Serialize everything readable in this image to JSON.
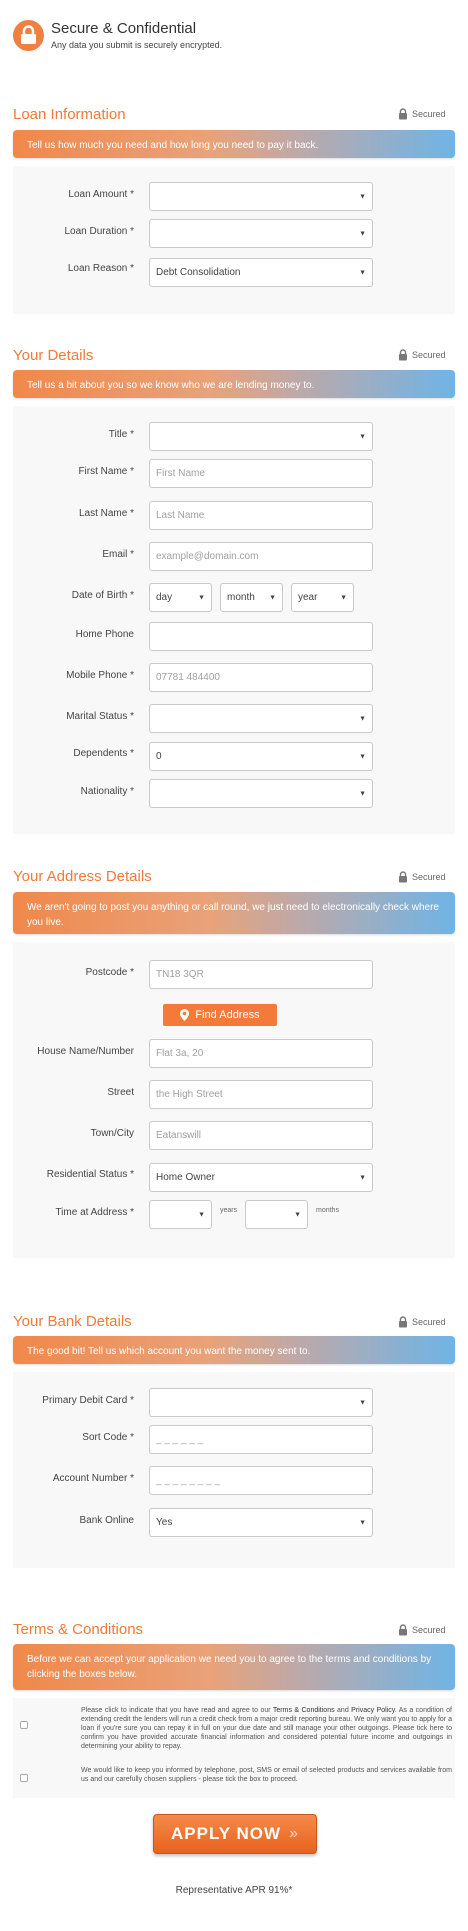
{
  "header": {
    "title": "Secure & Confidential",
    "subtitle": "Any data you submit is securely encrypted.",
    "icon": "lock-icon"
  },
  "secured_label": "Secured",
  "loan": {
    "title": "Loan Information",
    "banner": "Tell us how much you need and how long you need to pay it back.",
    "amount_label": "Loan Amount *",
    "amount_value": "",
    "duration_label": "Loan Duration *",
    "duration_value": "",
    "reason_label": "Loan Reason *",
    "reason_value": "Debt Consolidation"
  },
  "details": {
    "title": "Your Details",
    "banner": "Tell us a bit about you so we know who we are lending money to.",
    "title_label": "Title *",
    "title_value": "",
    "first_label": "First Name *",
    "first_placeholder": "First Name",
    "last_label": "Last Name *",
    "last_placeholder": "Last Name",
    "email_label": "Email *",
    "email_placeholder": "example@domain.com",
    "dob_label": "Date of Birth *",
    "dob_day": "day",
    "dob_month": "month",
    "dob_year": "year",
    "home_label": "Home Phone",
    "mobile_label": "Mobile Phone *",
    "mobile_placeholder": "07781 484400",
    "marital_label": "Marital Status *",
    "marital_value": "",
    "dependents_label": "Dependents *",
    "dependents_value": "0",
    "nationality_label": "Nationality *",
    "nationality_value": ""
  },
  "address": {
    "title": "Your Address Details",
    "banner": "We aren't going to post you anything or call round, we just need to electronically check where you live.",
    "postcode_label": "Postcode *",
    "postcode_placeholder": "TN18 3QR",
    "find_button": "Find Address",
    "house_label": "House Name/Number",
    "house_placeholder": "Flat 3a, 20",
    "street_label": "Street",
    "street_placeholder": "the High Street",
    "town_label": "Town/City",
    "town_placeholder": "Eatanswill",
    "residential_label": "Residential Status *",
    "residential_value": "Home Owner",
    "time_label": "Time at Address *",
    "years_unit": "years",
    "months_unit": "months"
  },
  "bank": {
    "title": "Your Bank Details",
    "banner": "The good bit! Tell us which account you want the money sent to.",
    "card_label": "Primary Debit Card *",
    "card_value": "",
    "sort_label": "Sort Code *",
    "sort_placeholder": "_ _ _ _ _ _",
    "account_label": "Account Number *",
    "account_placeholder": "_ _ _ _ _ _ _ _",
    "online_label": "Bank Online",
    "online_value": "Yes"
  },
  "terms": {
    "title": "Terms & Conditions",
    "banner": "Before we can accept your application we need you to agree to the terms and conditions by clicking the boxes below.",
    "text1_a": "Please click to indicate that you have read and agree to our ",
    "terms_link": "Terms & Conditions",
    "text1_and": " and ",
    "privacy_link": "Privacy Policy",
    "text1_b": ". As a condition of extending credit the lenders will run a credit check from a major credit reporting bureau. We only want you to apply for a loan if you're sure you can repay it in full on your due date and still manage your other outgoings. Please tick here to confirm you have provided accurate financial information and considered potential future income and outgoings in determining your ability to repay.",
    "text2": "We would like to keep you informed by telephone, post, SMS or email of selected products and services available from us and our carefully chosen suppliers - please tick the box to proceed."
  },
  "apply_button": "APPLY NOW",
  "apr_text": "Representative APR 91%*",
  "colors": {
    "accent": "#f07a3a",
    "banner_blue": "#6fb4e6",
    "panel": "#f8f8f8"
  }
}
